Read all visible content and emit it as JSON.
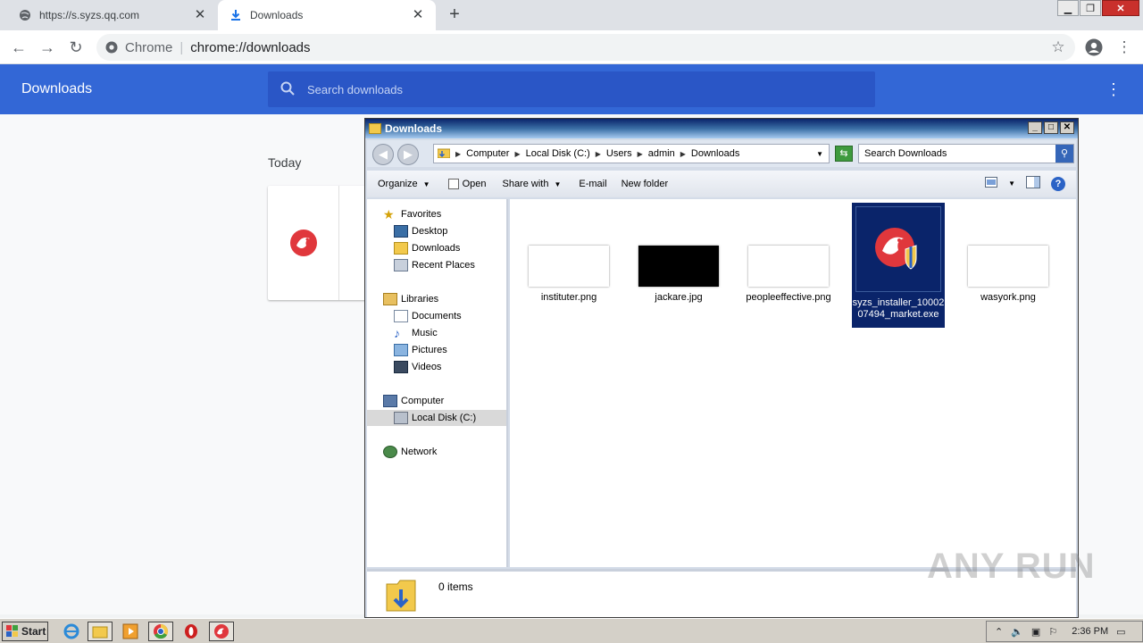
{
  "browser": {
    "tabs": [
      {
        "label": "https://s.syzs.qq.com",
        "icon": "globe-icon",
        "active": false
      },
      {
        "label": "Downloads",
        "icon": "download-icon",
        "active": true
      }
    ],
    "omnibox": {
      "scheme_label": "Chrome",
      "url": "chrome://downloads"
    }
  },
  "downloads_page": {
    "title": "Downloads",
    "search_placeholder": "Search downloads",
    "date_header": "Today"
  },
  "explorer": {
    "title": "Downloads",
    "breadcrumbs": [
      "Computer",
      "Local Disk (C:)",
      "Users",
      "admin",
      "Downloads"
    ],
    "search_placeholder": "Search Downloads",
    "commands": [
      "Organize",
      "Open",
      "Share with",
      "E-mail",
      "New folder"
    ],
    "nav": {
      "favorites": {
        "label": "Favorites",
        "items": [
          "Desktop",
          "Downloads",
          "Recent Places"
        ]
      },
      "libraries": {
        "label": "Libraries",
        "items": [
          "Documents",
          "Music",
          "Pictures",
          "Videos"
        ]
      },
      "computer": {
        "label": "Computer",
        "items": [
          "Local Disk (C:)"
        ]
      },
      "network": {
        "label": "Network"
      }
    },
    "files": [
      {
        "name": "instituter.png",
        "thumb": "light"
      },
      {
        "name": "jackare.jpg",
        "thumb": "dark"
      },
      {
        "name": "peopleeffective.png",
        "thumb": "light"
      },
      {
        "name": "syzs_installer_1000207494_market.exe",
        "thumb": "app",
        "selected": true
      },
      {
        "name": "wasyork.png",
        "thumb": "light"
      }
    ],
    "details": {
      "count": "0 items"
    }
  },
  "taskbar": {
    "start_label": "Start",
    "clock": "2:36 PM"
  },
  "watermark": "ANY RUN",
  "colors": {
    "chrome_blue": "#3367d6",
    "selection": "#0a246a",
    "app_red": "#e0373c"
  }
}
